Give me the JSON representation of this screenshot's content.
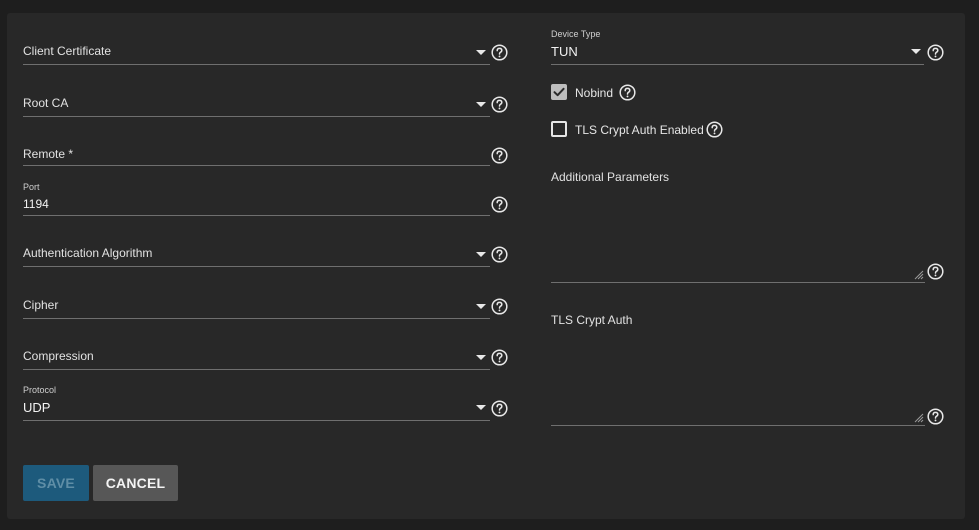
{
  "left_column": {
    "client_certificate": {
      "label": "Client Certificate"
    },
    "root_ca": {
      "label": "Root CA"
    },
    "remote": {
      "label": "Remote *"
    },
    "port": {
      "label": "Port",
      "value": "1194"
    },
    "authentication_algorithm": {
      "label": "Authentication Algorithm"
    },
    "cipher": {
      "label": "Cipher"
    },
    "compression": {
      "label": "Compression"
    },
    "protocol": {
      "label": "Protocol",
      "value": "UDP"
    }
  },
  "right_column": {
    "device_type": {
      "label": "Device Type",
      "value": "TUN"
    },
    "nobind": {
      "label": "Nobind",
      "checked": true
    },
    "tls_crypt_auth_enabled": {
      "label": "TLS Crypt Auth Enabled",
      "checked": false
    },
    "additional_parameters": {
      "label": "Additional Parameters",
      "value": ""
    },
    "tls_crypt_auth": {
      "label": "TLS Crypt Auth",
      "value": ""
    }
  },
  "actions": {
    "save_label": "SAVE",
    "cancel_label": "CANCEL"
  },
  "colors": {
    "background": "#1e1e1e",
    "card": "#282828",
    "save_button": "#1d5a7c",
    "cancel_button": "#575757",
    "underline": "#6f6f6f"
  },
  "icons": {
    "help": "help-circle-icon",
    "dropdown": "caret-down-icon",
    "check": "check-icon",
    "resize": "resize-handle-icon"
  }
}
